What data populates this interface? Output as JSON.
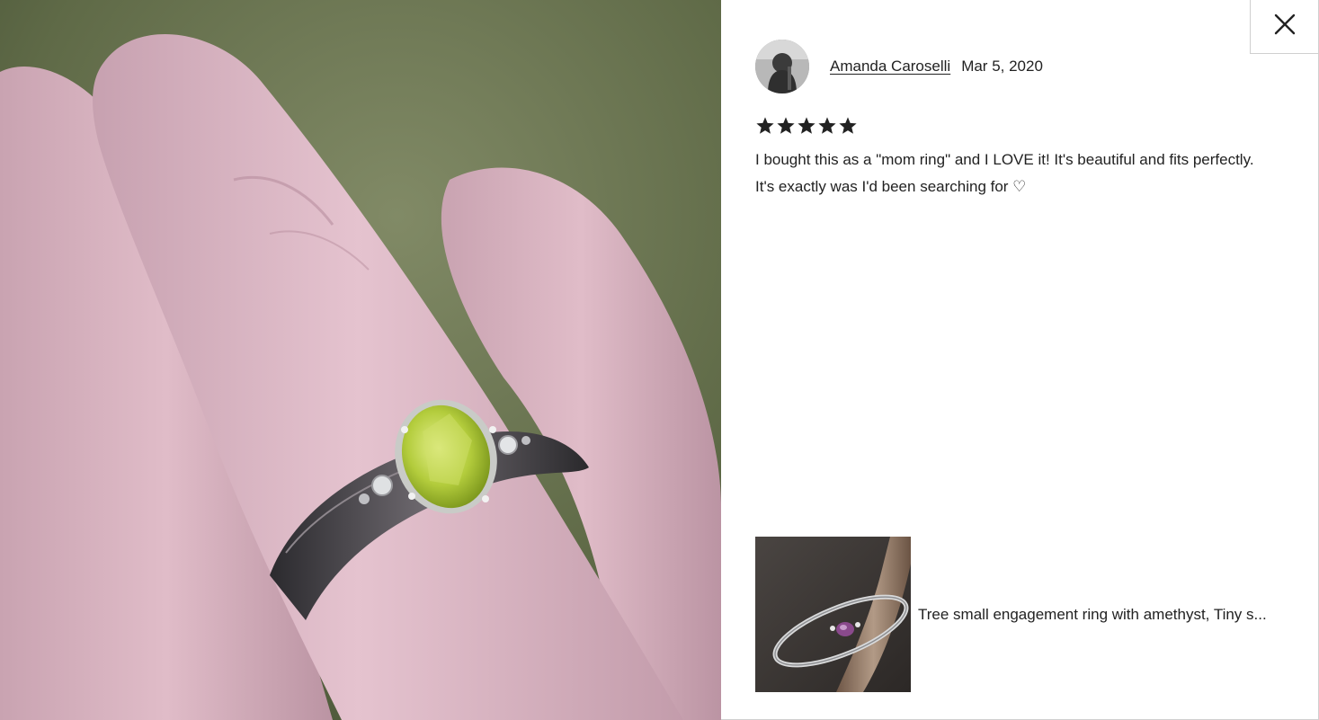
{
  "close_button": {
    "icon": "close-icon",
    "label": "Close"
  },
  "review": {
    "reviewer_name": "Amanda Caroselli",
    "date": "Mar 5, 2020",
    "rating": 5,
    "rating_max": 5,
    "text": "I bought this as a \"mom ring\" and I LOVE it! It's beautiful and fits perfectly. It's exactly was I'd been searching for ♡"
  },
  "listing": {
    "title": "Tree small engagement ring with amethyst, Tiny s..."
  },
  "colors": {
    "text": "#222222",
    "star": "#222222",
    "border": "#cfcfcf",
    "background": "#ffffff"
  }
}
